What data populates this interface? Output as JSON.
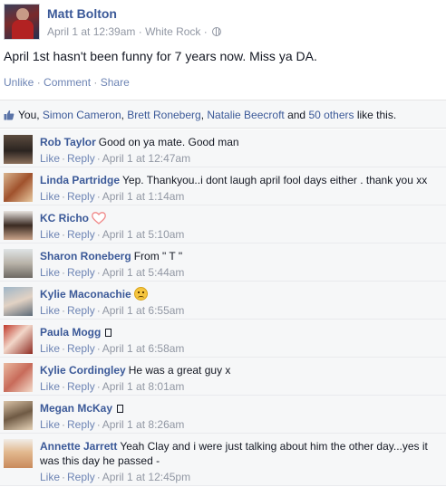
{
  "post": {
    "author": "Matt Bolton",
    "timestamp": "April 1 at 12:39am",
    "location_sep": " · ",
    "location": "White Rock",
    "privacy_sep": " · ",
    "text": "April 1st hasn't been funny for 7 years now. Miss ya DA.",
    "actions": {
      "unlike": "Unlike",
      "comment": "Comment",
      "share": "Share",
      "sep": " · "
    }
  },
  "likes": {
    "you": "You",
    "comma": ", ",
    "people": [
      "Simon Cameron",
      "Brett Roneberg",
      "Natalie Beecroft"
    ],
    "and": " and ",
    "others": "50 others",
    "suffix": " like this.",
    "accent": "#3b5998"
  },
  "comment_actions": {
    "like": "Like",
    "reply": "Reply",
    "sep": "·"
  },
  "comments": [
    {
      "name": "Rob Taylor",
      "text": "Good on ya mate. Good man",
      "time": "April 1 at 12:47am"
    },
    {
      "name": "Linda Partridge",
      "text": "Yep. Thankyou..i dont laugh april fool days either . thank you xx",
      "time": "April 1 at 1:14am"
    },
    {
      "name": "KC Richo",
      "text": "",
      "emoji": "heart-icon",
      "time": "April 1 at 5:10am"
    },
    {
      "name": "Sharon Roneberg",
      "text": "From \" T \"",
      "time": "April 1 at 5:44am"
    },
    {
      "name": "Kylie Maconachie",
      "text": "",
      "emoji": "crying-face-icon",
      "time": "April 1 at 6:55am"
    },
    {
      "name": "Paula Mogg",
      "text": "",
      "emoji": "box-glyph",
      "time": "April 1 at 6:58am"
    },
    {
      "name": "Kylie Cordingley",
      "text": "He was a great guy x",
      "time": "April 1 at 8:01am"
    },
    {
      "name": "Megan McKay",
      "text": "",
      "emoji": "box-glyph",
      "time": "April 1 at 8:26am"
    },
    {
      "name": "Annette Jarrett",
      "text": "Yeah Clay and i were just talking about him the other day...yes it was this day he passed -",
      "time": "April 1 at 12:45pm"
    }
  ]
}
